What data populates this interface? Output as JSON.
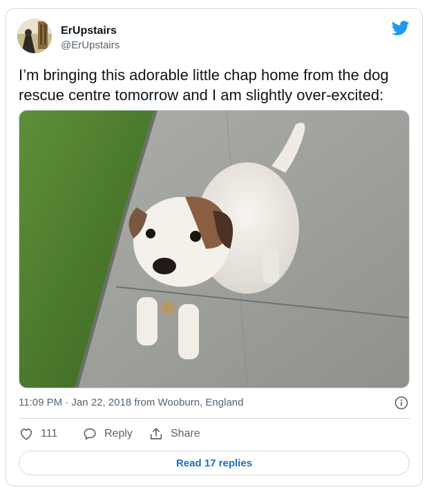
{
  "tweet": {
    "display_name": "ErUpstairs",
    "handle": "@ErUpstairs",
    "text": "I’m bringing this adorable little chap home from the dog rescue centre tomorrow and I am slightly over-excited:",
    "photo_icon": "dog-photo",
    "timestamp": "11:09 PM · Jan 22, 2018 from Wooburn, England",
    "like_count": "111",
    "reply_label": "Reply",
    "share_label": "Share",
    "read_replies_label": "Read 17 replies"
  },
  "icons": {
    "brand": "twitter-bird-icon",
    "info": "info-icon",
    "like": "heart-icon",
    "reply": "speech-bubble-icon",
    "share": "share-upload-icon"
  },
  "colors": {
    "twitter_blue": "#1d9bf0",
    "link_blue": "#1b6ec2",
    "text_primary": "#0f1419",
    "text_secondary": "#536471",
    "border": "#cfd9de"
  }
}
